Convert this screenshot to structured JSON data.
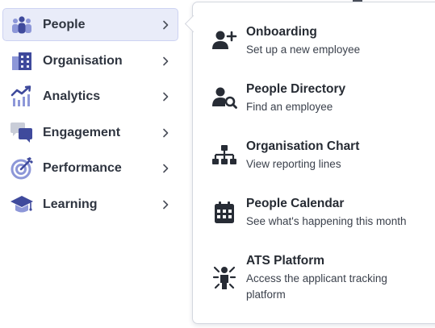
{
  "nav": {
    "items": [
      {
        "label": "People",
        "icon": "people-icon",
        "active": true
      },
      {
        "label": "Organisation",
        "icon": "building-icon",
        "active": false
      },
      {
        "label": "Analytics",
        "icon": "analytics-icon",
        "active": false
      },
      {
        "label": "Engagement",
        "icon": "chat-bubbles-icon",
        "active": false
      },
      {
        "label": "Performance",
        "icon": "target-icon",
        "active": false
      },
      {
        "label": "Learning",
        "icon": "graduation-cap-icon",
        "active": false
      }
    ]
  },
  "flyout": {
    "items": [
      {
        "title": "Onboarding",
        "description": "Set up a new employee",
        "icon": "user-plus-icon"
      },
      {
        "title": "People Directory",
        "description": "Find an employee",
        "icon": "user-search-icon"
      },
      {
        "title": "Organisation Chart",
        "description": "View reporting lines",
        "icon": "org-chart-icon"
      },
      {
        "title": "People Calendar",
        "description": "See what's happening this month",
        "icon": "calendar-icon"
      },
      {
        "title": "ATS Platform",
        "description": "Access the applicant tracking platform",
        "icon": "applicant-icon"
      }
    ]
  },
  "colors": {
    "accent": "#3f4a9c",
    "accent_light": "#8d97d8",
    "active_bg": "#e9ecf9",
    "text": "#2f3540",
    "icon_dark": "#272c35"
  }
}
